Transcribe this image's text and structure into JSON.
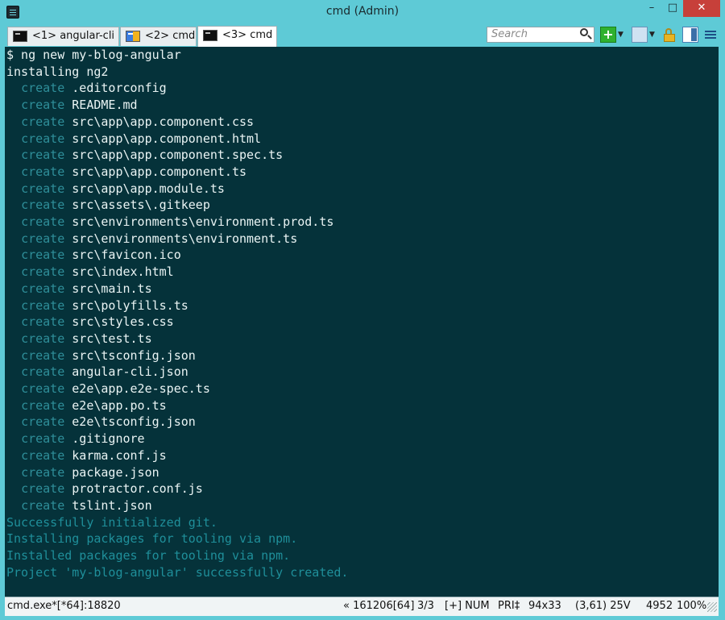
{
  "window": {
    "title": "cmd (Admin)"
  },
  "titlebar_buttons": {
    "minimize": "–",
    "maximize": "□",
    "close": "✕"
  },
  "tabs": [
    {
      "label": "<1> angular-cli",
      "active": false
    },
    {
      "label": "<2> cmd",
      "active": false
    },
    {
      "label": "<3> cmd",
      "active": true
    }
  ],
  "search": {
    "placeholder": "Search"
  },
  "toolbar": {
    "add_label": "+",
    "dropdown_glyph": "▼"
  },
  "console": {
    "prompt_line": "$ ng new my-blog-angular",
    "installing_line": "installing ng2",
    "create_word": "create",
    "created_files": [
      ".editorconfig",
      "README.md",
      "src\\app\\app.component.css",
      "src\\app\\app.component.html",
      "src\\app\\app.component.spec.ts",
      "src\\app\\app.component.ts",
      "src\\app\\app.module.ts",
      "src\\assets\\.gitkeep",
      "src\\environments\\environment.prod.ts",
      "src\\environments\\environment.ts",
      "src\\favicon.ico",
      "src\\index.html",
      "src\\main.ts",
      "src\\polyfills.ts",
      "src\\styles.css",
      "src\\test.ts",
      "src\\tsconfig.json",
      "angular-cli.json",
      "e2e\\app.e2e-spec.ts",
      "e2e\\app.po.ts",
      "e2e\\tsconfig.json",
      ".gitignore",
      "karma.conf.js",
      "package.json",
      "protractor.conf.js",
      "tslint.json"
    ],
    "messages": [
      "Successfully initialized git.",
      "Installing packages for tooling via npm.",
      "Installed packages for tooling via npm.",
      "Project 'my-blog-angular' successfully created."
    ]
  },
  "statusbar": {
    "process": "cmd.exe*[*64]:18820",
    "build": "« 161206[64]",
    "console_index": "3/3",
    "keys": "[+] NUM",
    "priority": "PRI‡",
    "size": "94x33",
    "cursor": "(3,61) 25V",
    "pid": "4952",
    "zoom": "100%"
  },
  "colors": {
    "frame": "#5ecad6",
    "console_bg": "#05323a",
    "console_text": "#eaf4f4",
    "create_keyword": "#2f8f9a",
    "message_text": "#1f8f9a",
    "close_button": "#c7403a"
  }
}
